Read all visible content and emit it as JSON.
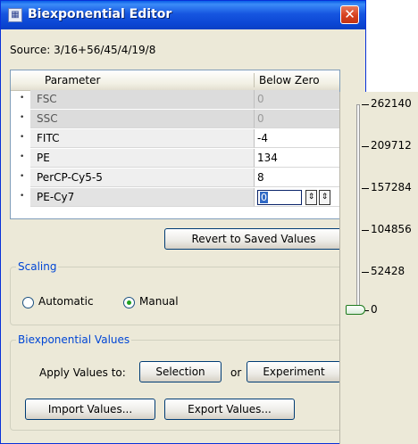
{
  "window": {
    "title": "Biexponential Editor",
    "close": "✕",
    "icon": "grid-app-icon"
  },
  "source": {
    "label": "Source: 3/16+56/45/4/19/8"
  },
  "grid": {
    "headers": [
      "Parameter",
      "Below Zero"
    ],
    "rows": [
      {
        "name": "FSC",
        "value": "0",
        "state": "disabled"
      },
      {
        "name": "SSC",
        "value": "0",
        "state": "disabled"
      },
      {
        "name": "FITC",
        "value": "-4",
        "state": "normal"
      },
      {
        "name": "PE",
        "value": "134",
        "state": "normal"
      },
      {
        "name": "PerCP-Cy5-5",
        "value": "8",
        "state": "normal"
      },
      {
        "name": "PE-Cy7",
        "value": "0",
        "state": "editing"
      }
    ],
    "row_marker": "•"
  },
  "buttons": {
    "revert": "Revert to Saved Values",
    "selection": "Selection",
    "experiment": "Experiment",
    "import": "Import Values...",
    "export": "Export Values..."
  },
  "scaling": {
    "title": "Scaling",
    "automatic": "Automatic",
    "manual": "Manual",
    "selected": "manual"
  },
  "biex": {
    "title": "Biexponential Values",
    "apply_label": "Apply Values to:",
    "or": "or"
  },
  "scale": {
    "labels": [
      "262140",
      "209712",
      "157284",
      "104856",
      "52428",
      "0"
    ],
    "slider_value": 0
  },
  "spinner": {
    "up_down": "⇕",
    "extra": "⇕"
  }
}
